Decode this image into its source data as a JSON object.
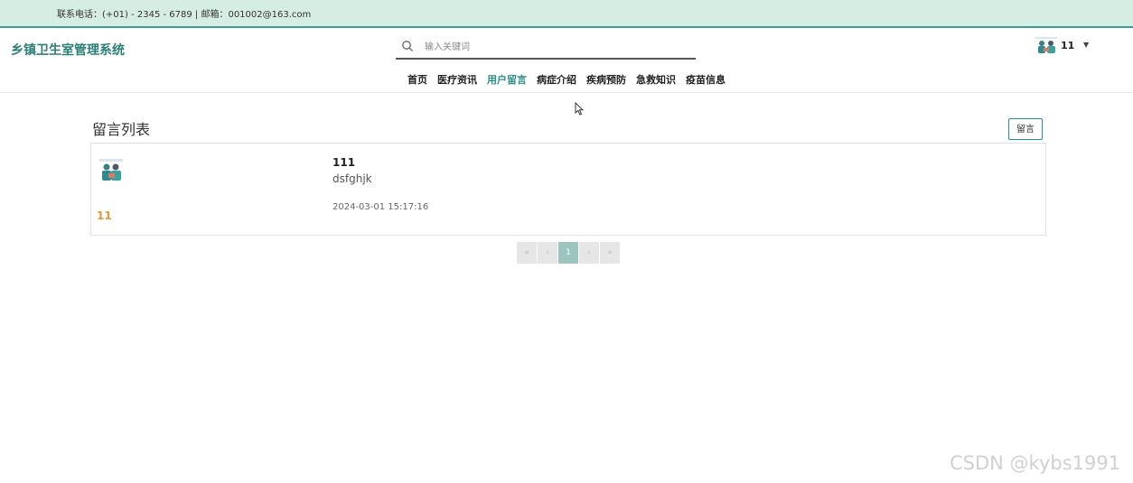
{
  "topbar": {
    "contact": "联系电话：(+01) - 2345 - 6789 | 邮箱：001002@163.com"
  },
  "header": {
    "logo": "乡镇卫生室管理系统",
    "search": {
      "placeholder": "输入关键词",
      "value": ""
    },
    "user": {
      "name": "11"
    }
  },
  "nav": [
    {
      "label": "首页",
      "active": false
    },
    {
      "label": "医疗资讯",
      "active": false
    },
    {
      "label": "用户留言",
      "active": true
    },
    {
      "label": "病症介绍",
      "active": false
    },
    {
      "label": "疾病预防",
      "active": false
    },
    {
      "label": "急救知识",
      "active": false
    },
    {
      "label": "疫苗信息",
      "active": false
    }
  ],
  "main": {
    "title": "留言列表",
    "message_button": "留言",
    "messages": [
      {
        "author": "11",
        "title": "111",
        "content": "dsfghjk",
        "time": "2024-03-01 15:17:16"
      }
    ],
    "pagination": {
      "first": "«",
      "prev": "‹",
      "current": "1",
      "next": "›",
      "last": "»"
    }
  },
  "watermark": "CSDN @kybs1991",
  "colors": {
    "accent": "#2b8f86",
    "topbar_bg": "#d6ede3",
    "author": "#e8943a"
  }
}
